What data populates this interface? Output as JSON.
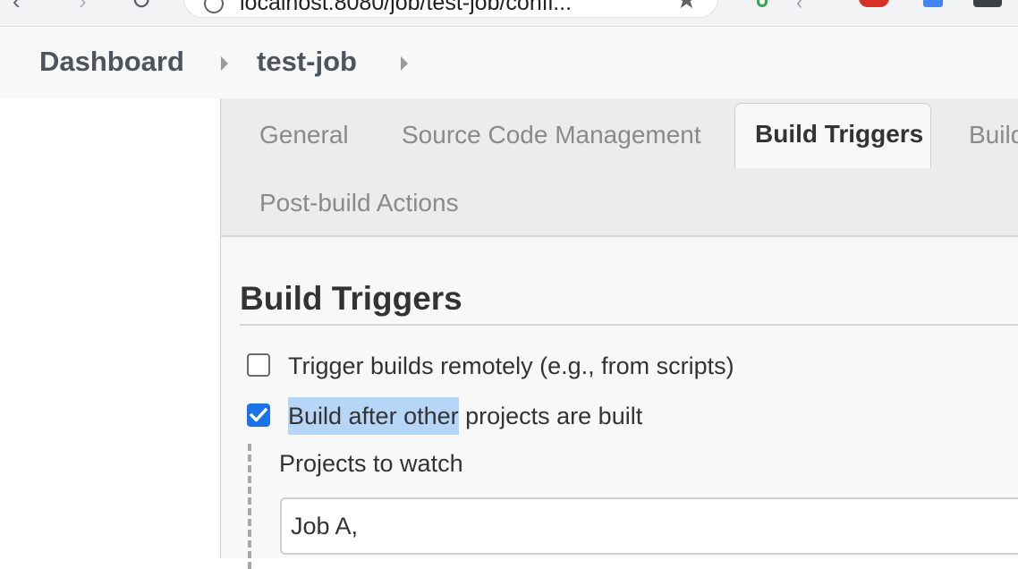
{
  "browser": {
    "url": "localhost:8080/job/test-job/confi..."
  },
  "breadcrumb": {
    "items": [
      "Dashboard",
      "test-job"
    ]
  },
  "tabs": {
    "items": [
      "General",
      "Source Code Management",
      "Build Triggers",
      "Build Environment",
      "Post-build Actions"
    ],
    "general": "General",
    "scm": "Source Code Management",
    "active": "Build Triggers",
    "build": "Build",
    "post": "Post-build Actions"
  },
  "section": {
    "title": "Build Triggers"
  },
  "triggers": {
    "remote": {
      "label": "Trigger builds remotely (e.g., from scripts)",
      "checked": false
    },
    "after_other": {
      "label_highlighted": "Build after other",
      "label_rest": " projects are built",
      "checked": true
    }
  },
  "projects_to_watch": {
    "label": "Projects to watch",
    "value": "Job A,"
  },
  "colors": {
    "accent": "#1a73e8",
    "selection": "#b6d6f7",
    "breadcrumb_bg": "#f8f8f8",
    "tabbar_bg": "#ececec"
  },
  "icons": [
    "back-arrow-icon",
    "forward-arrow-icon",
    "reload-icon",
    "site-info-icon",
    "bookmark-star-icon",
    "breadcrumb-chevron-icon",
    "checkmark-icon"
  ]
}
